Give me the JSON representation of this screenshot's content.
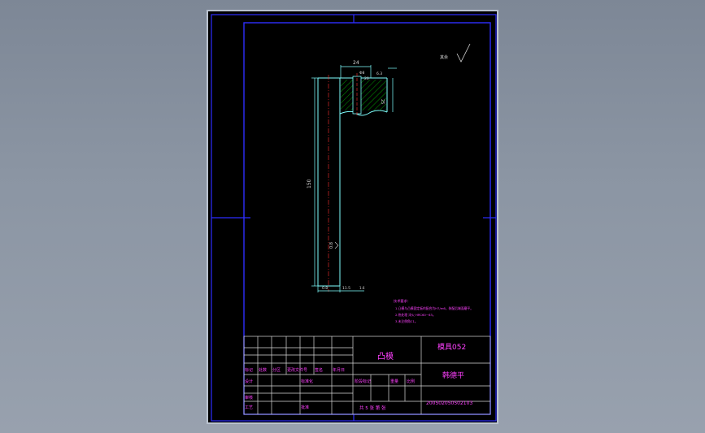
{
  "drawing": {
    "surface_roughness_label": "其余",
    "dims": {
      "width_top": "24",
      "top_small": "Φ8",
      "top_small2": "20",
      "side_small": "6.3",
      "right_height": "25",
      "total_length": "150",
      "roughness_mid": "0.8",
      "roughness_bottom_left": "0.8",
      "dim_bottom": "11.5",
      "dim_bottom2": "1.6"
    },
    "notes_title": "技术要求：",
    "notes": [
      "1.凸模与凸模固定板的配合为H7/m6，装配后端面磨平。",
      "2.热处理 淬火 HRC60~63。",
      "3.未注倒角C1。"
    ]
  },
  "title_block": {
    "part_name": "凸模",
    "drawing_no": "模具052",
    "author_name": "韩德平",
    "student_id": "200502050502103",
    "revision_header": [
      "标记",
      "处数",
      "分区",
      "更改文件号",
      "签名",
      "年月日"
    ],
    "design_label": "设计",
    "standardize_label": "标准化",
    "stage_headers": [
      "阶段标记",
      "重量",
      "比例"
    ],
    "review_label": "审核",
    "process_label": "工艺",
    "approve_label": "批准",
    "sheet_info": "共 5 张 第 张"
  },
  "colors": {
    "frame": "#2d2dff",
    "outline": "#7fffff",
    "text": "#ff40ff",
    "hatch": "#00c000"
  }
}
